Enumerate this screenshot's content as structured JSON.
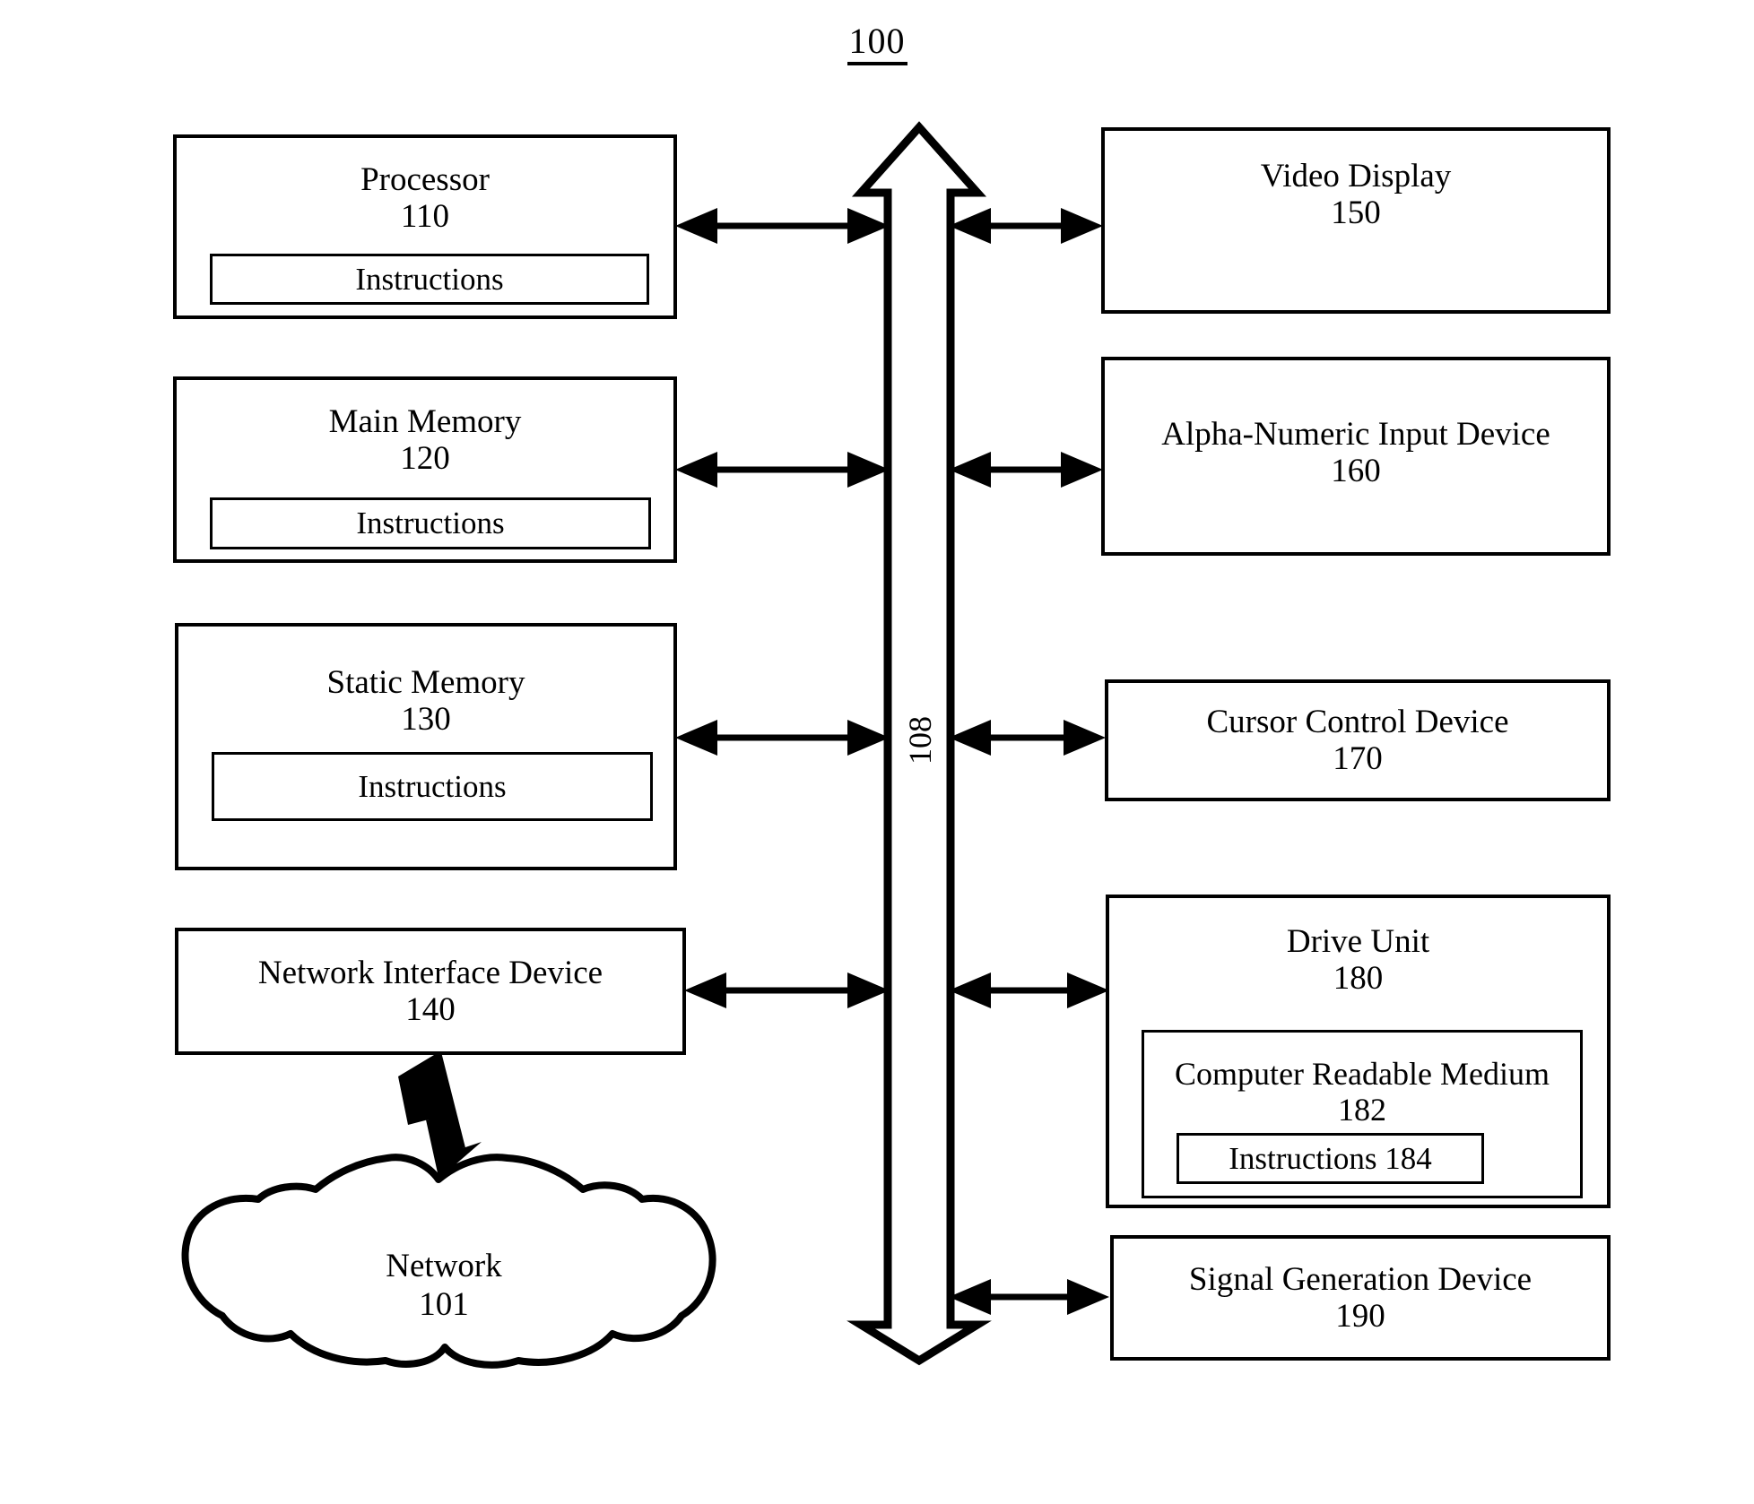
{
  "figure": {
    "number": "100"
  },
  "bus": {
    "label": "108"
  },
  "left_boxes": [
    {
      "title": "Processor",
      "number": "110",
      "sub": {
        "label": "Instructions"
      }
    },
    {
      "title": "Main Memory",
      "number": "120",
      "sub": {
        "label": "Instructions"
      }
    },
    {
      "title": "Static Memory",
      "number": "130",
      "sub": {
        "label": "Instructions"
      }
    },
    {
      "title": "Network Interface Device",
      "number": "140",
      "sub": null
    }
  ],
  "network": {
    "title": "Network",
    "number": "101"
  },
  "right_boxes": [
    {
      "title": "Video Display",
      "number": "150"
    },
    {
      "title": "Alpha-Numeric Input Device",
      "number": "160"
    },
    {
      "title": "Cursor Control Device",
      "number": "170"
    },
    {
      "title": "Drive Unit",
      "number": "180",
      "medium": {
        "title": "Computer Readable Medium",
        "number": "182",
        "instructions": "Instructions 184"
      }
    },
    {
      "title": "Signal Generation Device",
      "number": "190"
    }
  ]
}
